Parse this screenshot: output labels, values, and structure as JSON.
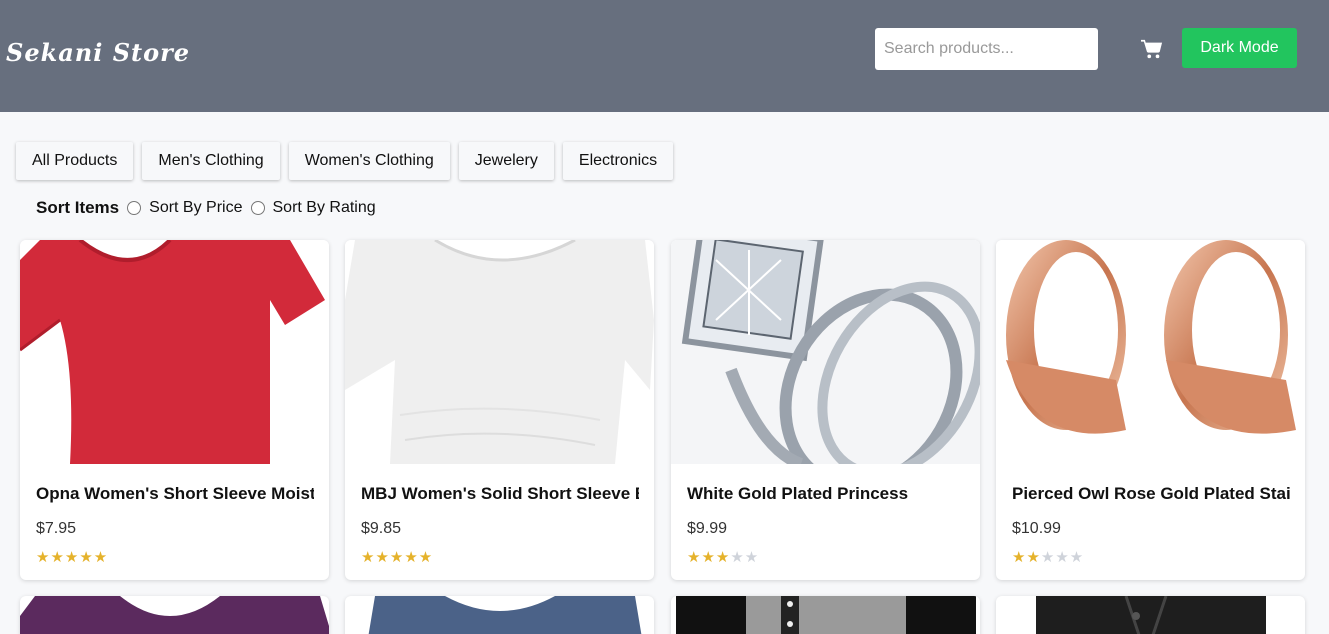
{
  "header": {
    "brand": "Sekani Store",
    "search_placeholder": "Search products...",
    "dark_mode_label": "Dark Mode"
  },
  "categories": [
    "All Products",
    "Men's Clothing",
    "Women's Clothing",
    "Jewelery",
    "Electronics"
  ],
  "sort": {
    "title": "Sort Items",
    "options": [
      "Sort By Price",
      "Sort By Rating"
    ]
  },
  "products": [
    {
      "title": "Opna Women's Short Sleeve Moisture",
      "price": "$7.95",
      "rating": 5
    },
    {
      "title": "MBJ Women's Solid Short Sleeve Boat Neck V",
      "price": "$9.85",
      "rating": 5
    },
    {
      "title": "White Gold Plated Princess",
      "price": "$9.99",
      "rating": 3
    },
    {
      "title": "Pierced Owl Rose Gold Plated Stainless Steel Double",
      "price": "$10.99",
      "rating": 2
    }
  ],
  "colors": {
    "header_bg": "#676f7e",
    "accent": "#22c55e",
    "star": "#e5b22b"
  }
}
